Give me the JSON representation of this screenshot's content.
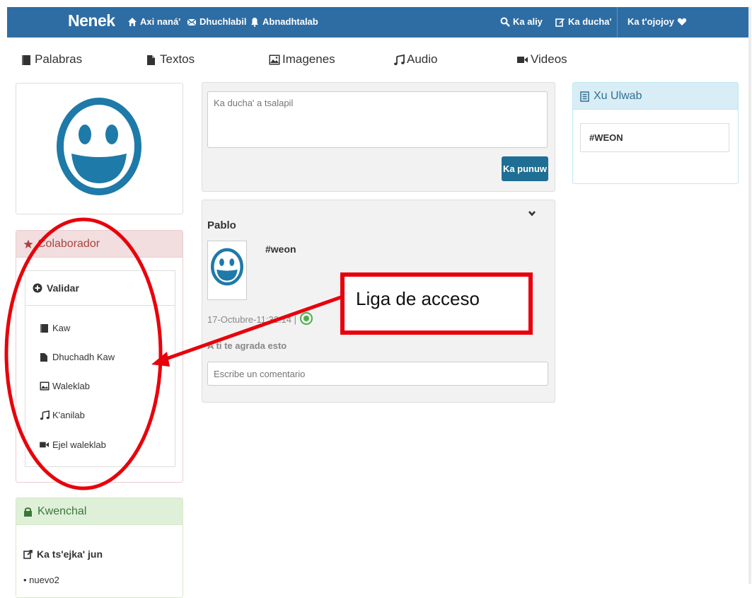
{
  "navbar": {
    "brand": "Nenek",
    "home": "Axi naná'",
    "messages": "Dhuchlabil",
    "notifications": "Abnadhtalab",
    "search": "Ka aliy",
    "write": "Ka ducha'",
    "user_menu": "Ka t'ojojoy",
    "color": "#2e6da4"
  },
  "categories": {
    "words": "Palabras",
    "texts": "Textos",
    "images": "Imagenes",
    "audio": "Audio",
    "videos": "Videos"
  },
  "collaborator": {
    "heading": "Colaborador",
    "validate_title": "Validar",
    "items": [
      "Kaw",
      "Dhuchadh Kaw",
      "Waleklab",
      "K'anilab",
      "Ejel waleklab"
    ]
  },
  "kwenchal": {
    "heading": "Kwenchal",
    "subheading": "Ka ts'ejka' jun",
    "first_item": "• nuevo2"
  },
  "composer": {
    "placeholder": "Ka ducha' a tsalapil",
    "submit": "Ka punuw"
  },
  "post": {
    "author": "Pablo",
    "text": "#weon",
    "timestamp": "17-Octubre-11:32:14 |",
    "likes_text": "A ti te agrada esto",
    "comment_placeholder": "Escribe un comentario"
  },
  "trends": {
    "heading": "Xu Ulwab",
    "tag": "#WEON"
  },
  "annotation": {
    "label": "Liga de acceso",
    "color": "#e8000b"
  }
}
